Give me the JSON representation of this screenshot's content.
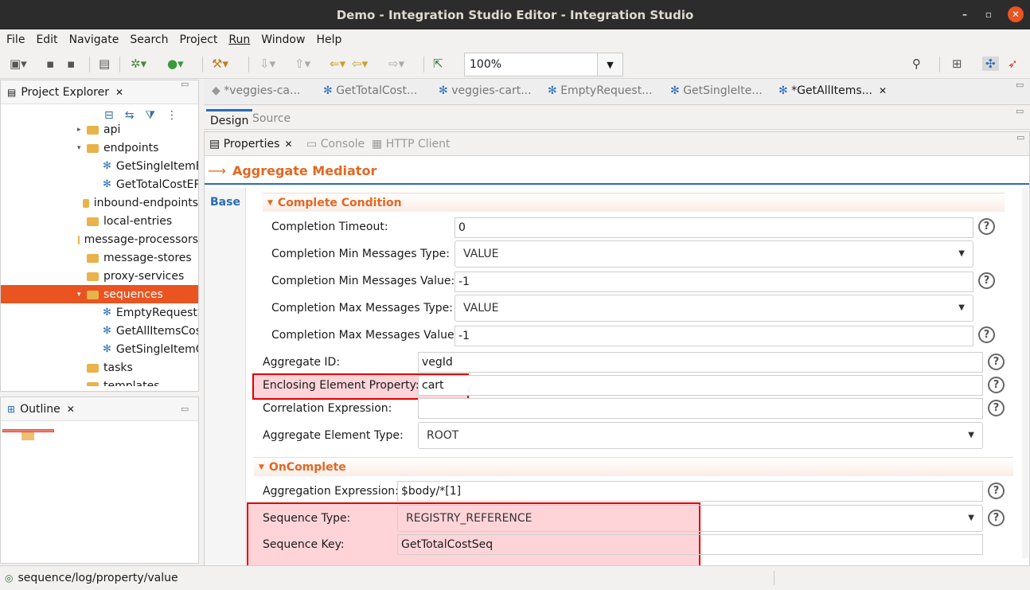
{
  "window": {
    "title": "Demo - Integration Studio Editor - Integration Studio"
  },
  "menu": [
    "File",
    "Edit",
    "Navigate",
    "Search",
    "Project",
    "Run",
    "Window",
    "Help"
  ],
  "toolbar": {
    "zoom": "100%"
  },
  "project_explorer": {
    "title": "Project Explorer",
    "nodes": [
      {
        "label": "api",
        "type": "folder",
        "indent": 2,
        "arrow": "▸"
      },
      {
        "label": "endpoints",
        "type": "folder",
        "indent": 2,
        "arrow": "▾"
      },
      {
        "label": "GetSingleItemEP",
        "type": "seq",
        "indent": 3
      },
      {
        "label": "GetTotalCostEP",
        "type": "seq",
        "indent": 3
      },
      {
        "label": "inbound-endpoints",
        "type": "folder",
        "indent": 2
      },
      {
        "label": "local-entries",
        "type": "folder",
        "indent": 2
      },
      {
        "label": "message-processors",
        "type": "folder",
        "indent": 2
      },
      {
        "label": "message-stores",
        "type": "folder",
        "indent": 2
      },
      {
        "label": "proxy-services",
        "type": "folder",
        "indent": 2
      },
      {
        "label": "sequences",
        "type": "folder",
        "indent": 2,
        "arrow": "▾",
        "selected": true
      },
      {
        "label": "EmptyRequestSeq",
        "type": "seq",
        "indent": 3
      },
      {
        "label": "GetAllItemsCostSeq",
        "type": "seq",
        "indent": 3
      },
      {
        "label": "GetSingleItemCostSeq",
        "type": "seq",
        "indent": 3
      },
      {
        "label": "tasks",
        "type": "folder",
        "indent": 2
      },
      {
        "label": "templates",
        "type": "folder",
        "indent": 2
      }
    ]
  },
  "outline": {
    "title": "Outline"
  },
  "editor_tabs": [
    {
      "label": "*veggies-ca...",
      "active": false
    },
    {
      "label": "GetTotalCost...",
      "active": false
    },
    {
      "label": "veggies-cart...",
      "active": false
    },
    {
      "label": "EmptyRequest...",
      "active": false
    },
    {
      "label": "GetSingleIte...",
      "active": false
    },
    {
      "label": "*GetAllItems...",
      "active": true
    }
  ],
  "design_source": {
    "design": "Design",
    "source": "Source"
  },
  "panel_tabs": {
    "properties": "Properties",
    "console": "Console",
    "http": "HTTP Client"
  },
  "mediator": {
    "title": "Aggregate Mediator",
    "base_tab": "Base"
  },
  "complete_condition": {
    "title": "Complete Condition",
    "timeout_label": "Completion Timeout:",
    "timeout": "0",
    "min_type_label": "Completion Min Messages Type:",
    "min_type": "VALUE",
    "min_value_label": "Completion Min Messages Value:",
    "min_value": "-1",
    "max_type_label": "Completion Max Messages Type:",
    "max_type": "VALUE",
    "max_value_label": "Completion Max Messages Value:",
    "max_value": "-1"
  },
  "aggregate": {
    "id_label": "Aggregate ID:",
    "id": "vegId",
    "enclosing_label": "Enclosing Element Property:",
    "enclosing": "cart",
    "correlation_label": "Correlation Expression:",
    "correlation": "",
    "element_type_label": "Aggregate Element Type:",
    "element_type": "ROOT"
  },
  "on_complete": {
    "title": "OnComplete",
    "expression_label": "Aggregation Expression:",
    "expression": "$body/*[1]",
    "seq_type_label": "Sequence Type:",
    "seq_type": "REGISTRY_REFERENCE",
    "seq_key_label": "Sequence Key:",
    "seq_key": "GetTotalCostSeq"
  },
  "status": {
    "path": "sequence/log/property/value"
  },
  "colors": {
    "accent": "#e95420",
    "section": "#e26722",
    "link": "#2a6bb7",
    "highlight": "#e00000"
  }
}
